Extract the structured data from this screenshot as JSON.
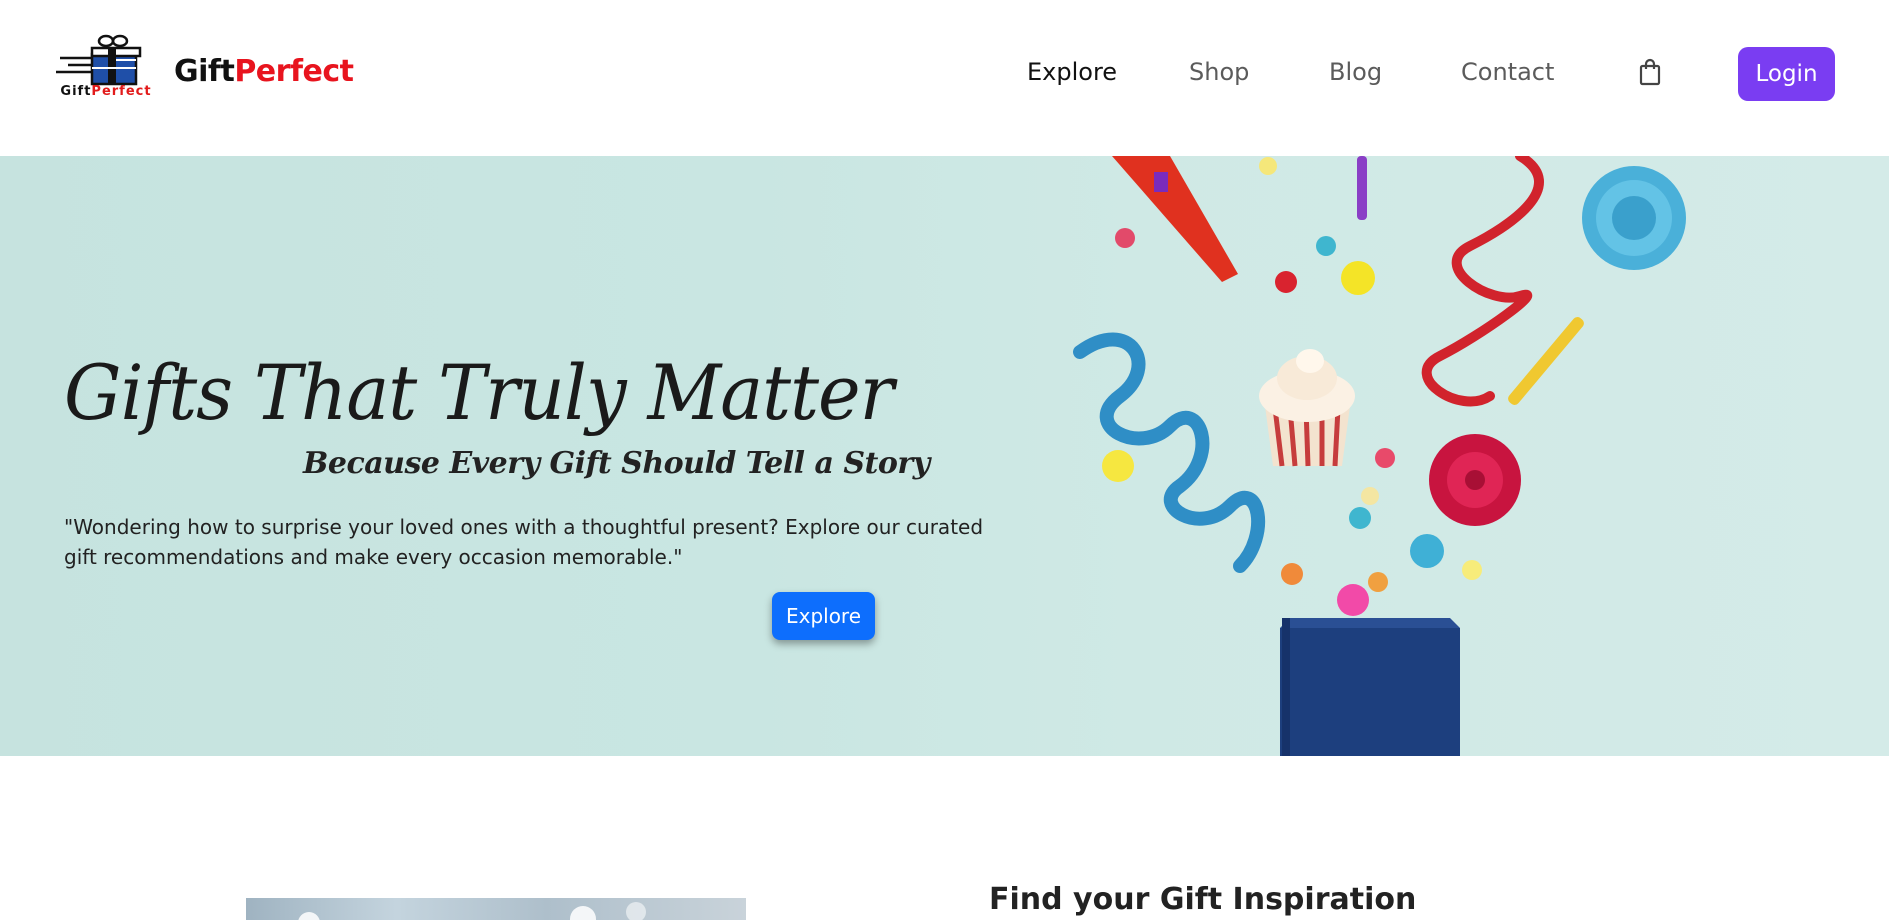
{
  "header": {
    "logo_caption_part1": "Gift",
    "logo_caption_part2": "Perfect",
    "brand_part1": "Gift",
    "brand_part2": "Perfect",
    "nav": {
      "explore": "Explore",
      "shop": "Shop",
      "blog": "Blog",
      "contact": "Contact"
    },
    "cart_icon": "shopping-bag-icon",
    "login_label": "Login"
  },
  "hero": {
    "title": "Gifts That Truly Matter",
    "subtitle": "Because Every Gift Should Tell a Story",
    "text": "\"Wondering how to surprise your loved ones with a thoughtful present? Explore our curated gift recommendations and make every occasion memorable.\"",
    "cta_label": "Explore"
  },
  "inspiration": {
    "title": "Find your Gift Inspiration"
  },
  "colors": {
    "brand_red": "#e8141e",
    "login_purple": "#7a3df2",
    "cta_blue": "#0d6efd",
    "hero_background": "#c9e6e2"
  }
}
